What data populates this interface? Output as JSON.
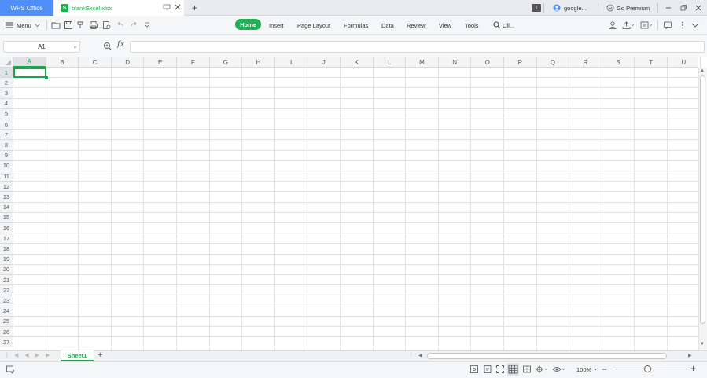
{
  "titlebar": {
    "app_tab": "WPS Office",
    "doc_tab": "blankExcel.xlsx",
    "doc_icon_letter": "S",
    "new_tab": "+",
    "window_count": "1",
    "account_name": "google...",
    "premium_label": "Go Premium"
  },
  "ribbon": {
    "menu_label": "Menu",
    "tabs": [
      "Home",
      "Insert",
      "Page Layout",
      "Formulas",
      "Data",
      "Review",
      "View",
      "Tools"
    ],
    "search_label": "Cli..."
  },
  "formula_bar": {
    "name_box": "A1",
    "fx_label": "fx",
    "formula_value": ""
  },
  "grid": {
    "columns": [
      "A",
      "B",
      "C",
      "D",
      "E",
      "F",
      "G",
      "H",
      "I",
      "J",
      "K",
      "L",
      "M",
      "N",
      "O",
      "P",
      "Q",
      "R",
      "S",
      "T",
      "U"
    ],
    "rows": [
      "1",
      "2",
      "3",
      "4",
      "5",
      "6",
      "7",
      "8",
      "9",
      "10",
      "11",
      "12",
      "13",
      "14",
      "15",
      "16",
      "17",
      "18",
      "19",
      "20",
      "21",
      "22",
      "23",
      "24",
      "25",
      "26",
      "27"
    ],
    "active_cell": "A1"
  },
  "sheets": {
    "tabs": [
      "Sheet1"
    ],
    "add_label": "+"
  },
  "statusbar": {
    "zoom": "100%",
    "zoom_level": 0.45
  },
  "colors": {
    "accent": "#1fb155",
    "wps_blue": "#4f8ff7"
  }
}
